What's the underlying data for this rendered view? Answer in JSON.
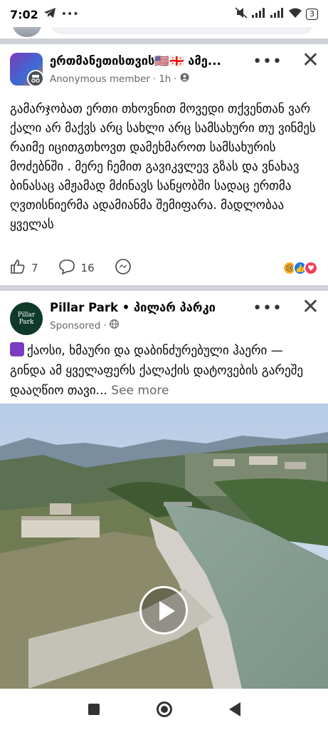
{
  "status_bar": {
    "time": "7:02",
    "battery": "3"
  },
  "posts": [
    {
      "author": "ერთმანეთისთვის🇺🇸🇬🇪 ამე...",
      "subtitle": "Anonymous member",
      "time": "1h",
      "text": "გამარჯობათ ერთი თხოვნით მოვედი თქვენთან  ვარ ქალი  არ მაქვს არც სახლი არც სამსახური თუ ვინმეს რაიმე იცითგთხოვთ დამეხმაროთ სამსახურის მოძებნში . მერე ჩემით გავიკვლევ გზას და ვნახავ ბინასაც ამჟამად მძინავს სანყობში სადაც ერთმა ღვთისნიერმა ადამიანმა შემიფარა. მადლობაა ყველას",
      "likes": "7",
      "comments": "16"
    },
    {
      "author": "Pillar Park • პილარ პარკი",
      "avatar_text": [
        "Pillar",
        "Park"
      ],
      "subtitle": "Sponsored",
      "text": "ქაოსი, ხმაური და დაბინძურებული ჰაერი — გინდა ამ ყველაფერს ქალაქის დატოვების გარეშე დააღწიო თავი...",
      "see_more": "See more"
    }
  ],
  "colors": {
    "accent": "#1877f2",
    "muted": "#65676b",
    "divider": "#cfd2d6"
  }
}
